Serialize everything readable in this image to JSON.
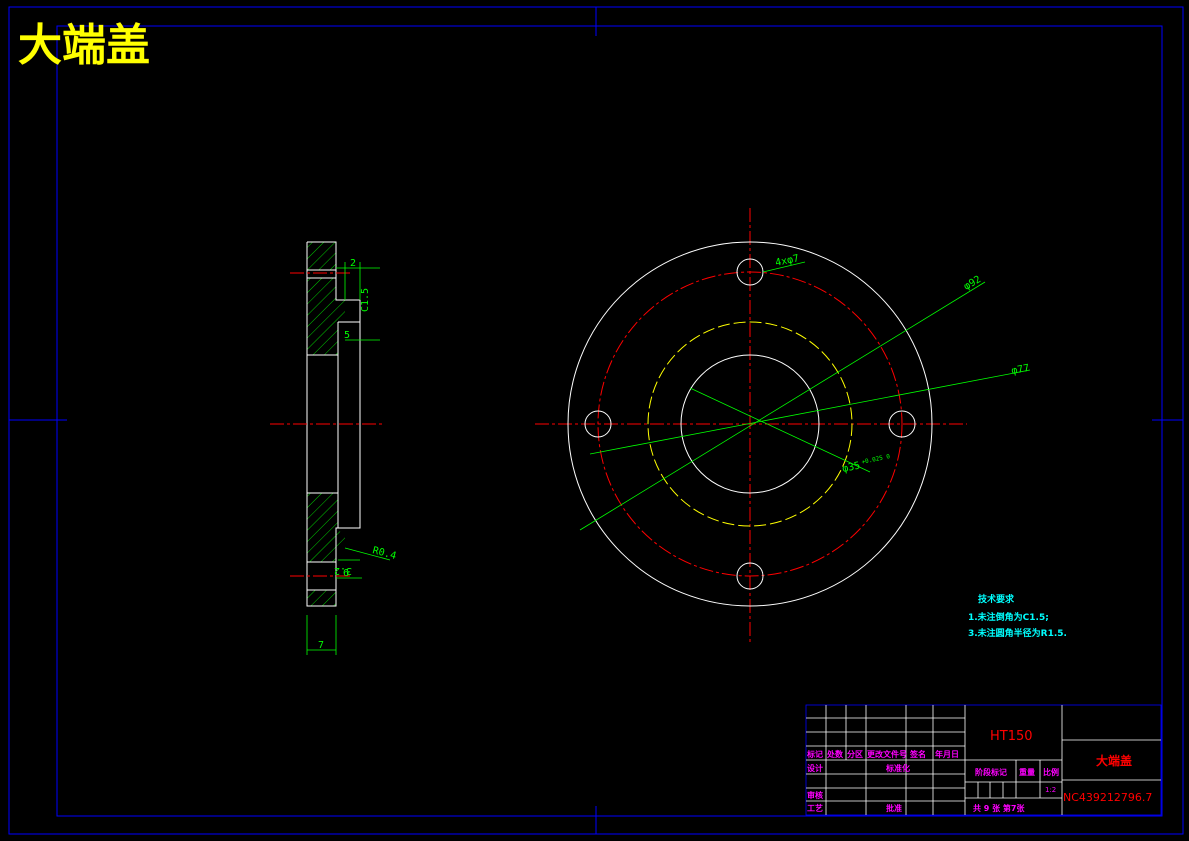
{
  "drawing": {
    "title": "大端盖",
    "colors": {
      "background": "#000000",
      "frame": "#0000ff",
      "outline": "#ffffff",
      "centerline": "#ff0000",
      "dimension": "#00ff00",
      "title": "#ffff00",
      "notes": "#00ffff",
      "table_text": "#ff00ff",
      "hidden": "#ffff00"
    }
  },
  "side_view": {
    "dims": {
      "top_width": "2",
      "chamfer": "C1.5",
      "step": "5",
      "fillet": "R0.4",
      "bottom": "3.2",
      "small": "6",
      "thickness": "7"
    }
  },
  "front_view": {
    "dims": {
      "holes": "4xφ7",
      "outer": "φ92",
      "pitch": "φ77",
      "bore": "φ35",
      "bore_tol": "+0.025 0"
    }
  },
  "notes": {
    "heading": "技术要求",
    "line1": "1.未注倒角为C1.5;",
    "line2": "3.未注圆角半径为R1.5."
  },
  "title_block": {
    "material": "HT150",
    "part_name": "大端盖",
    "drawing_number": "NC439212796.7",
    "scale_value": "1:2",
    "headers": [
      "标记",
      "处数",
      "分区",
      "更改文件号",
      "签名",
      "年月日"
    ],
    "design": "设计",
    "standardize": "标准化",
    "stage_mark": "阶段标记",
    "weight": "重量",
    "scale": "比例",
    "review": "审核",
    "process": "工艺",
    "approve": "批准",
    "sheets": "共 9 张 第7张"
  }
}
